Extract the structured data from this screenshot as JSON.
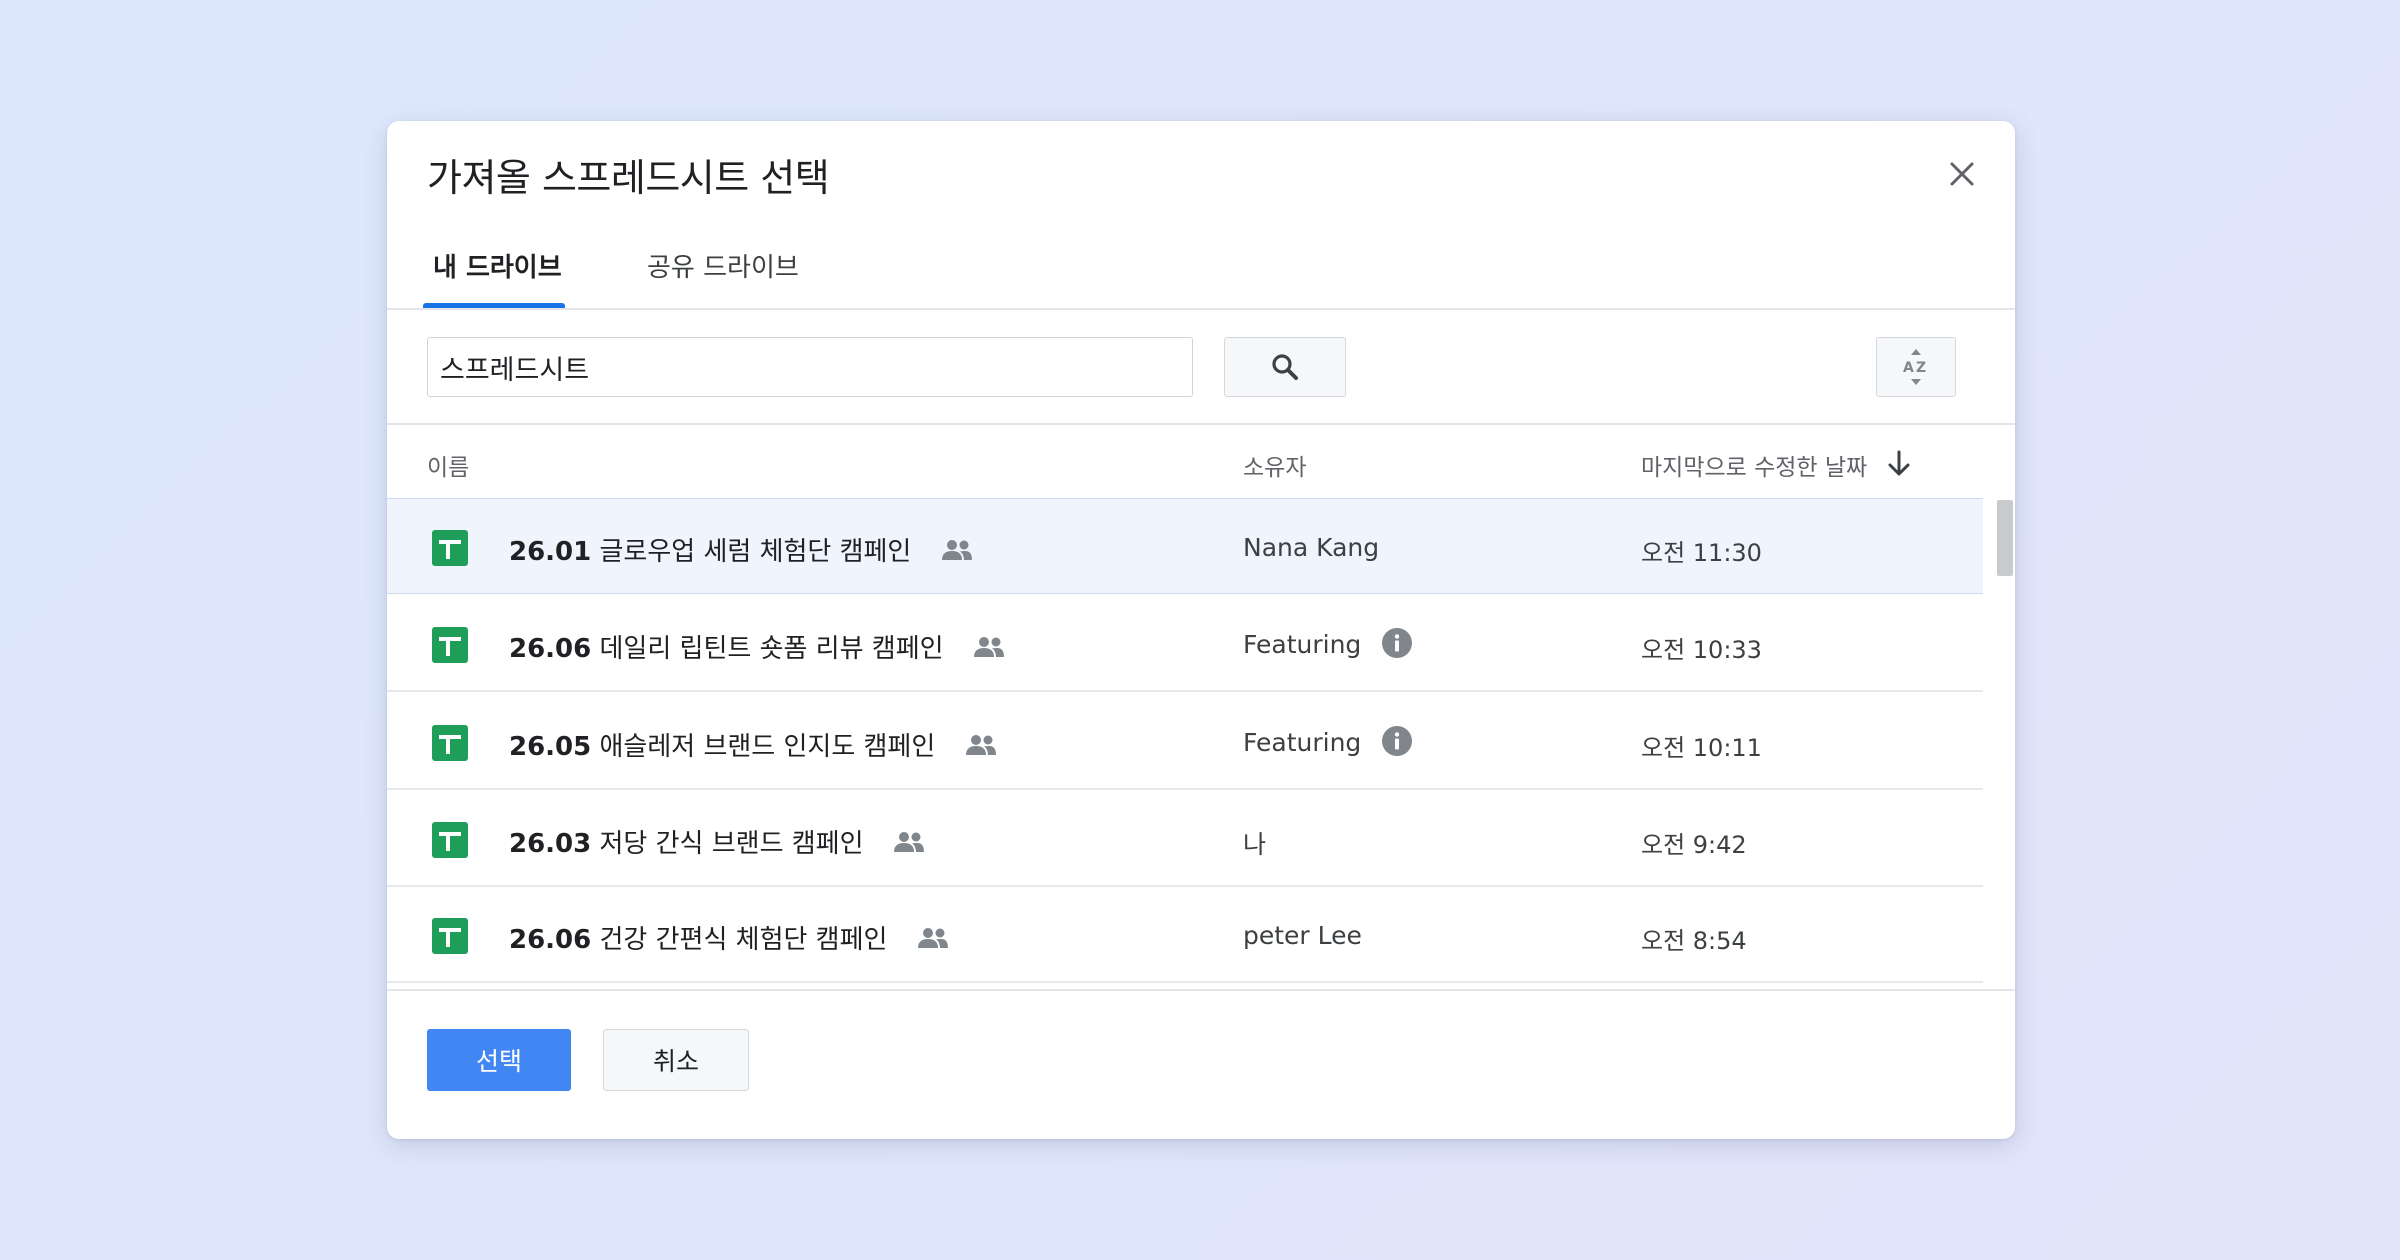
{
  "dialog": {
    "title": "가져올 스프레드시트 선택",
    "close_icon": "close-icon"
  },
  "tabs": [
    {
      "label": "내 드라이브",
      "active": true
    },
    {
      "label": "공유 드라이브",
      "active": false
    }
  ],
  "search": {
    "value": "스프레드시트",
    "placeholder": "",
    "button_icon": "search-icon",
    "sort_icon": "az-sort-icon"
  },
  "columns": {
    "name": "이름",
    "owner": "소유자",
    "modified": "마지막으로 수정한 날짜",
    "sort_icon": "arrow-down-icon"
  },
  "files": [
    {
      "num": "26.01",
      "title": "글로우업 세럼 체험단 캠페인",
      "owner": "Nana Kang",
      "owner_info": false,
      "modified": "오전 11:30",
      "selected": true
    },
    {
      "num": "26.06",
      "title": "데일리 립틴트 숏폼 리뷰 캠페인",
      "owner": "Featuring",
      "owner_info": true,
      "modified": "오전 10:33",
      "selected": false
    },
    {
      "num": "26.05",
      "title": "애슬레저 브랜드 인지도 캠페인",
      "owner": "Featuring",
      "owner_info": true,
      "modified": "오전 10:11",
      "selected": false
    },
    {
      "num": "26.03",
      "title": "저당 간식 브랜드 캠페인",
      "owner": "나",
      "owner_info": false,
      "modified": "오전 9:42",
      "selected": false
    },
    {
      "num": "26.06",
      "title": "건강 간편식 체험단 캠페인",
      "owner": "peter Lee",
      "owner_info": false,
      "modified": "오전 8:54",
      "selected": false
    }
  ],
  "actions": {
    "select_label": "선택",
    "cancel_label": "취소"
  },
  "colors": {
    "accent": "#1a73e8",
    "primary_button": "#4286f4",
    "sheets_green": "#1e9e58",
    "selected_row": "#f0f4fc"
  }
}
